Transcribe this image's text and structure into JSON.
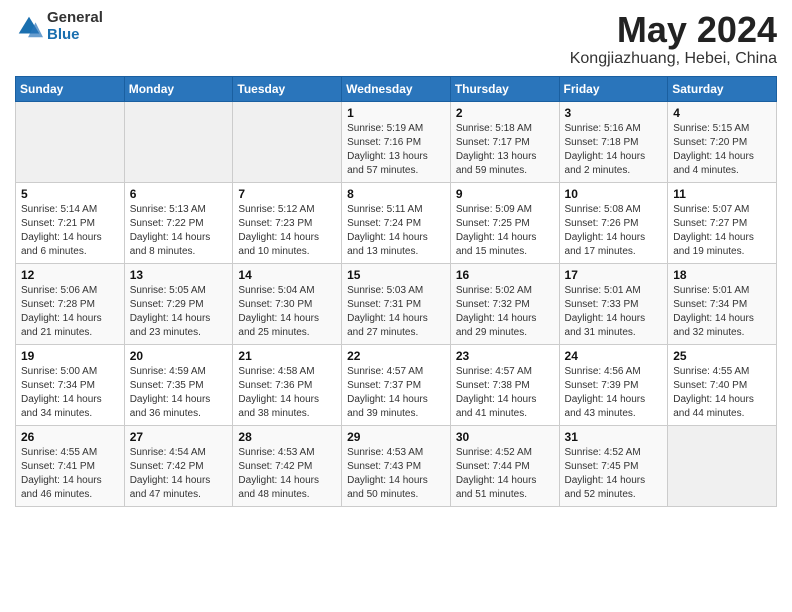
{
  "logo": {
    "general": "General",
    "blue": "Blue"
  },
  "header": {
    "month": "May 2024",
    "location": "Kongjiazhuang, Hebei, China"
  },
  "weekdays": [
    "Sunday",
    "Monday",
    "Tuesday",
    "Wednesday",
    "Thursday",
    "Friday",
    "Saturday"
  ],
  "weeks": [
    [
      {
        "day": "",
        "info": ""
      },
      {
        "day": "",
        "info": ""
      },
      {
        "day": "",
        "info": ""
      },
      {
        "day": "1",
        "info": "Sunrise: 5:19 AM\nSunset: 7:16 PM\nDaylight: 13 hours\nand 57 minutes."
      },
      {
        "day": "2",
        "info": "Sunrise: 5:18 AM\nSunset: 7:17 PM\nDaylight: 13 hours\nand 59 minutes."
      },
      {
        "day": "3",
        "info": "Sunrise: 5:16 AM\nSunset: 7:18 PM\nDaylight: 14 hours\nand 2 minutes."
      },
      {
        "day": "4",
        "info": "Sunrise: 5:15 AM\nSunset: 7:20 PM\nDaylight: 14 hours\nand 4 minutes."
      }
    ],
    [
      {
        "day": "5",
        "info": "Sunrise: 5:14 AM\nSunset: 7:21 PM\nDaylight: 14 hours\nand 6 minutes."
      },
      {
        "day": "6",
        "info": "Sunrise: 5:13 AM\nSunset: 7:22 PM\nDaylight: 14 hours\nand 8 minutes."
      },
      {
        "day": "7",
        "info": "Sunrise: 5:12 AM\nSunset: 7:23 PM\nDaylight: 14 hours\nand 10 minutes."
      },
      {
        "day": "8",
        "info": "Sunrise: 5:11 AM\nSunset: 7:24 PM\nDaylight: 14 hours\nand 13 minutes."
      },
      {
        "day": "9",
        "info": "Sunrise: 5:09 AM\nSunset: 7:25 PM\nDaylight: 14 hours\nand 15 minutes."
      },
      {
        "day": "10",
        "info": "Sunrise: 5:08 AM\nSunset: 7:26 PM\nDaylight: 14 hours\nand 17 minutes."
      },
      {
        "day": "11",
        "info": "Sunrise: 5:07 AM\nSunset: 7:27 PM\nDaylight: 14 hours\nand 19 minutes."
      }
    ],
    [
      {
        "day": "12",
        "info": "Sunrise: 5:06 AM\nSunset: 7:28 PM\nDaylight: 14 hours\nand 21 minutes."
      },
      {
        "day": "13",
        "info": "Sunrise: 5:05 AM\nSunset: 7:29 PM\nDaylight: 14 hours\nand 23 minutes."
      },
      {
        "day": "14",
        "info": "Sunrise: 5:04 AM\nSunset: 7:30 PM\nDaylight: 14 hours\nand 25 minutes."
      },
      {
        "day": "15",
        "info": "Sunrise: 5:03 AM\nSunset: 7:31 PM\nDaylight: 14 hours\nand 27 minutes."
      },
      {
        "day": "16",
        "info": "Sunrise: 5:02 AM\nSunset: 7:32 PM\nDaylight: 14 hours\nand 29 minutes."
      },
      {
        "day": "17",
        "info": "Sunrise: 5:01 AM\nSunset: 7:33 PM\nDaylight: 14 hours\nand 31 minutes."
      },
      {
        "day": "18",
        "info": "Sunrise: 5:01 AM\nSunset: 7:34 PM\nDaylight: 14 hours\nand 32 minutes."
      }
    ],
    [
      {
        "day": "19",
        "info": "Sunrise: 5:00 AM\nSunset: 7:34 PM\nDaylight: 14 hours\nand 34 minutes."
      },
      {
        "day": "20",
        "info": "Sunrise: 4:59 AM\nSunset: 7:35 PM\nDaylight: 14 hours\nand 36 minutes."
      },
      {
        "day": "21",
        "info": "Sunrise: 4:58 AM\nSunset: 7:36 PM\nDaylight: 14 hours\nand 38 minutes."
      },
      {
        "day": "22",
        "info": "Sunrise: 4:57 AM\nSunset: 7:37 PM\nDaylight: 14 hours\nand 39 minutes."
      },
      {
        "day": "23",
        "info": "Sunrise: 4:57 AM\nSunset: 7:38 PM\nDaylight: 14 hours\nand 41 minutes."
      },
      {
        "day": "24",
        "info": "Sunrise: 4:56 AM\nSunset: 7:39 PM\nDaylight: 14 hours\nand 43 minutes."
      },
      {
        "day": "25",
        "info": "Sunrise: 4:55 AM\nSunset: 7:40 PM\nDaylight: 14 hours\nand 44 minutes."
      }
    ],
    [
      {
        "day": "26",
        "info": "Sunrise: 4:55 AM\nSunset: 7:41 PM\nDaylight: 14 hours\nand 46 minutes."
      },
      {
        "day": "27",
        "info": "Sunrise: 4:54 AM\nSunset: 7:42 PM\nDaylight: 14 hours\nand 47 minutes."
      },
      {
        "day": "28",
        "info": "Sunrise: 4:53 AM\nSunset: 7:42 PM\nDaylight: 14 hours\nand 48 minutes."
      },
      {
        "day": "29",
        "info": "Sunrise: 4:53 AM\nSunset: 7:43 PM\nDaylight: 14 hours\nand 50 minutes."
      },
      {
        "day": "30",
        "info": "Sunrise: 4:52 AM\nSunset: 7:44 PM\nDaylight: 14 hours\nand 51 minutes."
      },
      {
        "day": "31",
        "info": "Sunrise: 4:52 AM\nSunset: 7:45 PM\nDaylight: 14 hours\nand 52 minutes."
      },
      {
        "day": "",
        "info": ""
      }
    ]
  ]
}
